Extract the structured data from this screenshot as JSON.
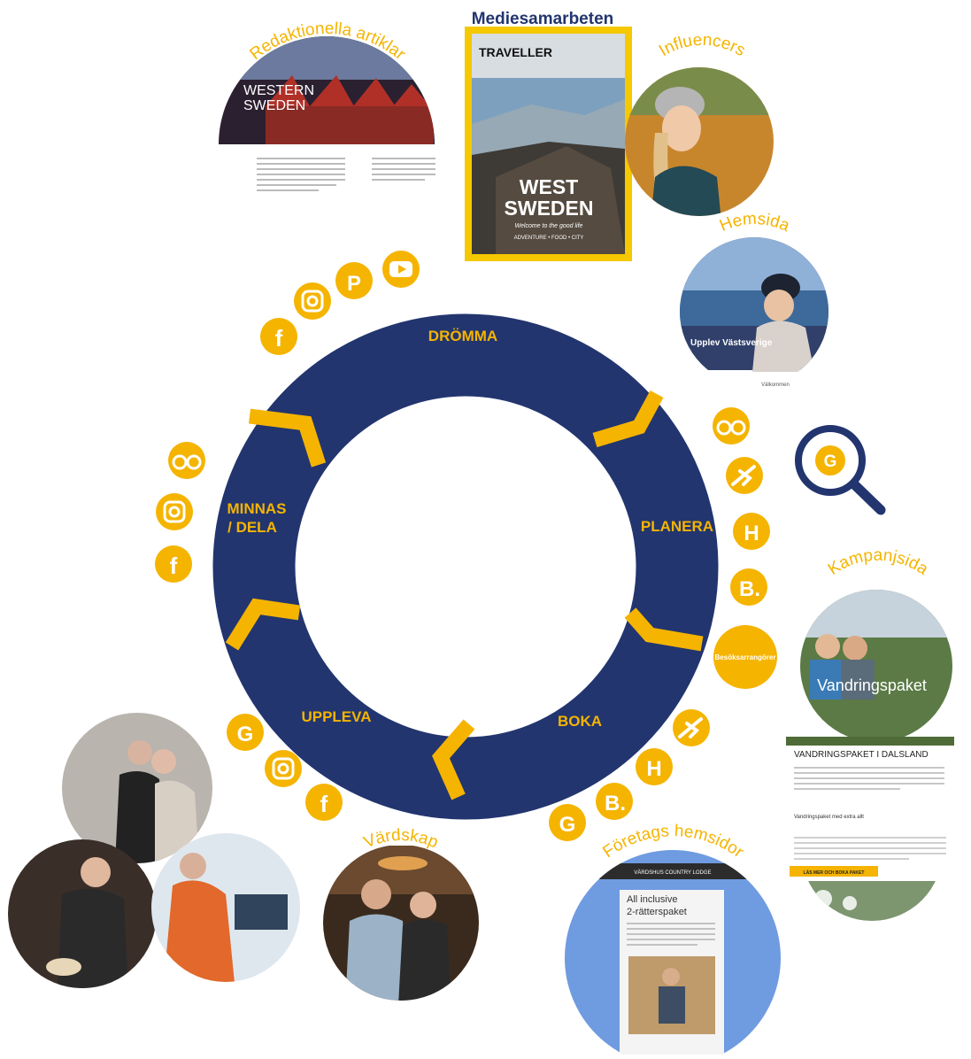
{
  "colors": {
    "navy": "#22356f",
    "accent": "#f5b400",
    "white": "#ffffff"
  },
  "top_label": "Mediesamarbeten",
  "wheel": {
    "stages": [
      {
        "id": "dromma",
        "label": "DRÖMMA"
      },
      {
        "id": "planera",
        "label": "PLANERA"
      },
      {
        "id": "boka",
        "label": "BOKA"
      },
      {
        "id": "uppleva",
        "label": "UPPLEVA"
      },
      {
        "id": "minnas",
        "label_line1": "MINNAS",
        "label_line2": "/ DELA"
      }
    ]
  },
  "arc_titles": {
    "redaktionella": "Redaktionella artiklar",
    "influencers": "Influencers",
    "hemsida": "Hemsida",
    "kampanjsida": "Kampanjsida",
    "foretags": "Företags hemsidor",
    "vardskap": "Värdskap"
  },
  "magazine": {
    "masthead": "TRAVELLER",
    "title_line1": "WEST",
    "title_line2": "SWEDEN",
    "tagline": "Welcome to the good life",
    "sub": "ADVENTURE • FOOD • CITY"
  },
  "article": {
    "headline_line1": "WESTERN",
    "headline_line2": "SWEDEN"
  },
  "hemsida": {
    "caption": "Upplev Västsverige",
    "footer": "Välkommen"
  },
  "kampanj": {
    "overlay": "Vandringspaket",
    "heading": "VANDRINGSPAKET I DALSLAND",
    "subheading": "Vandringspaket med extra allt",
    "button": "LÄS MER OCH BOKA PAKET"
  },
  "foretag": {
    "site_name": "VÄRDSHUS COUNTRY LODGE",
    "title_line1": "All inclusive",
    "title_line2": "2-rätterspaket"
  },
  "icons": {
    "dromma": [
      "facebook-icon",
      "instagram-icon",
      "pinterest-icon",
      "youtube-icon"
    ],
    "planera": [
      "tripadvisor-icon",
      "flight-icon",
      "hotels-icon",
      "booking-icon"
    ],
    "planera_badge": "Besöksarrangörer",
    "boka": [
      "flight-icon",
      "hotels-icon",
      "booking-icon",
      "google-icon"
    ],
    "uppleva": [
      "google-icon",
      "instagram-icon",
      "facebook-icon"
    ],
    "minnas": [
      "tripadvisor-icon",
      "instagram-icon",
      "facebook-icon"
    ],
    "search": "google-search-icon"
  }
}
